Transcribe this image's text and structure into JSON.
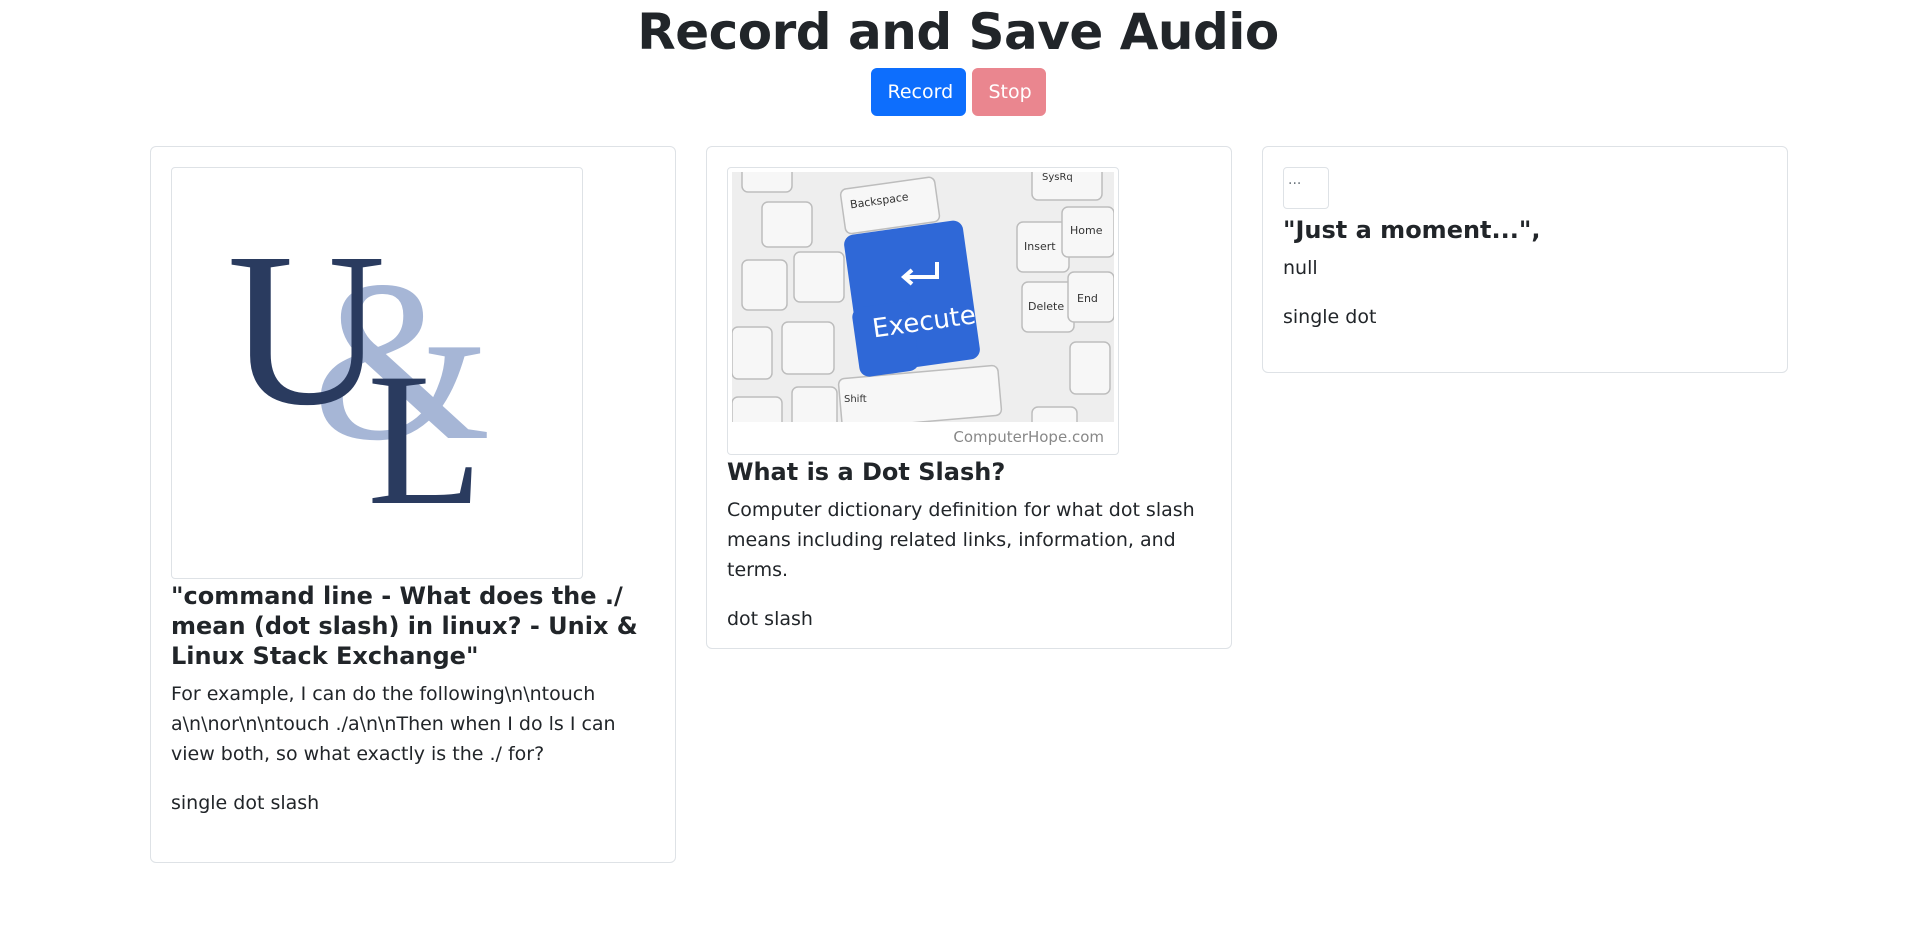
{
  "header": {
    "title": "Record and Save Audio"
  },
  "controls": {
    "record_label": "Record",
    "stop_label": "Stop"
  },
  "colors": {
    "record": "#0d6efd",
    "stop": "#ea868f",
    "logo_dark": "#2a3b5f",
    "logo_light": "#a6b6d6",
    "execute_key": "#2f68d7"
  },
  "cards": [
    {
      "image_icon": "unix-linux-logo",
      "logo_text": {
        "u": "U",
        "amp": "&",
        "l": "L"
      },
      "title": "\"command line - What does the ./ mean (dot slash) in linux? - Unix & Linux Stack Exchange\"",
      "description": "For example, I can do the following\\n\\ntouch a\\n\\nor\\n\\ntouch ./a\\n\\nThen when I do ls I can view both, so what exactly is the ./ for?",
      "query": "single dot slash"
    },
    {
      "image_icon": "execute-keyboard-photo",
      "keys": {
        "execute": "Execute",
        "backspace": "Backspace",
        "insert": "Insert",
        "home": "Home",
        "delete": "Delete",
        "end": "End",
        "shift": "Shift",
        "sysrq": "SysRq"
      },
      "watermark": "ComputerHope.com",
      "title": "What is a Dot Slash?",
      "description": "Computer dictionary definition for what dot slash means including related links, information, and terms.",
      "query": "dot slash"
    },
    {
      "image_icon": "broken-image-icon",
      "image_alt": "...",
      "title": "\"Just a moment...\",",
      "description": "null",
      "query": "single dot"
    }
  ]
}
